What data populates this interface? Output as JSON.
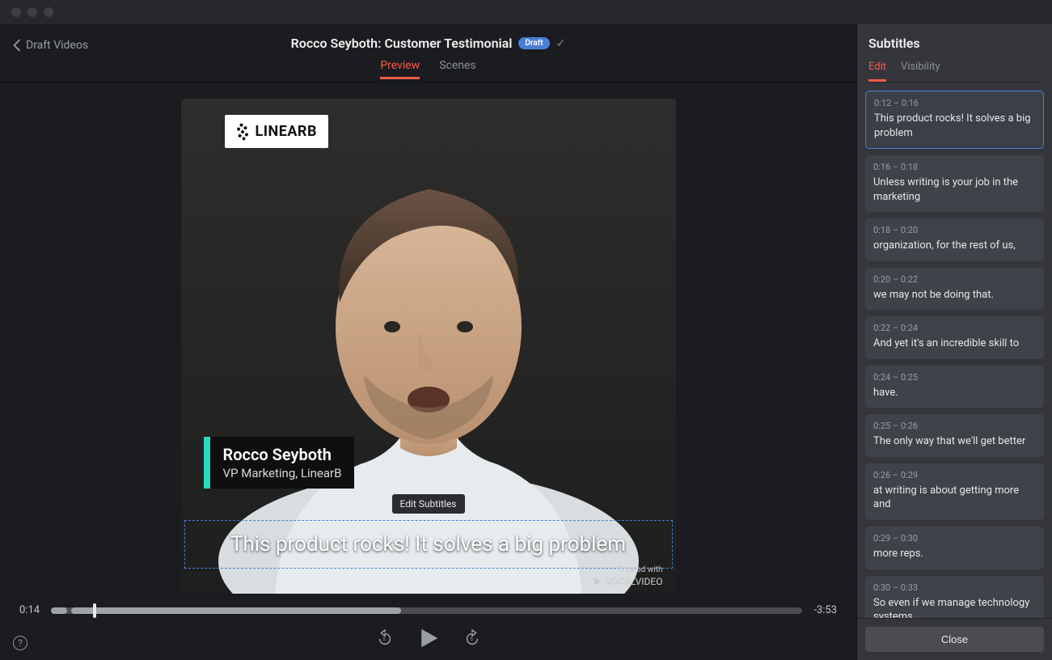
{
  "header": {
    "back_label": "Draft Videos",
    "title": "Rocco Seyboth: Customer Testimonial",
    "badge": "Draft",
    "tabs": {
      "preview": "Preview",
      "scenes": "Scenes"
    }
  },
  "video": {
    "logo_text": "LINEARB",
    "lower_third": {
      "name": "Rocco Seyboth",
      "title": "VP Marketing, LinearB"
    },
    "tooltip": "Edit Subtitles",
    "subtitle_text": "This product rocks! It solves a big problem",
    "watermark": {
      "prefix": "Created with",
      "brand": "VOCALVIDEO"
    }
  },
  "controls": {
    "current_time": "0:14",
    "remaining_time": "-3:53"
  },
  "sidebar": {
    "title": "Subtitles",
    "tabs": {
      "edit": "Edit",
      "visibility": "Visibility"
    },
    "close_label": "Close",
    "items": [
      {
        "time": "0:12 – 0:16",
        "text": "This product rocks! It solves a big problem",
        "selected": true
      },
      {
        "time": "0:16 – 0:18",
        "text": "Unless writing is your job in the marketing"
      },
      {
        "time": "0:18 – 0:20",
        "text": "organization, for the rest of us,"
      },
      {
        "time": "0:20 – 0:22",
        "text": "we may not be doing that."
      },
      {
        "time": "0:22 – 0:24",
        "text": "And yet it's an incredible skill to"
      },
      {
        "time": "0:24 – 0:25",
        "text": "have."
      },
      {
        "time": "0:25 – 0:26",
        "text": "The only way that we'll get better"
      },
      {
        "time": "0:26 – 0:29",
        "text": "at writing is about getting more and"
      },
      {
        "time": "0:29 – 0:30",
        "text": "more reps."
      },
      {
        "time": "0:30 – 0:33",
        "text": "So even if we manage technology systems"
      }
    ]
  }
}
